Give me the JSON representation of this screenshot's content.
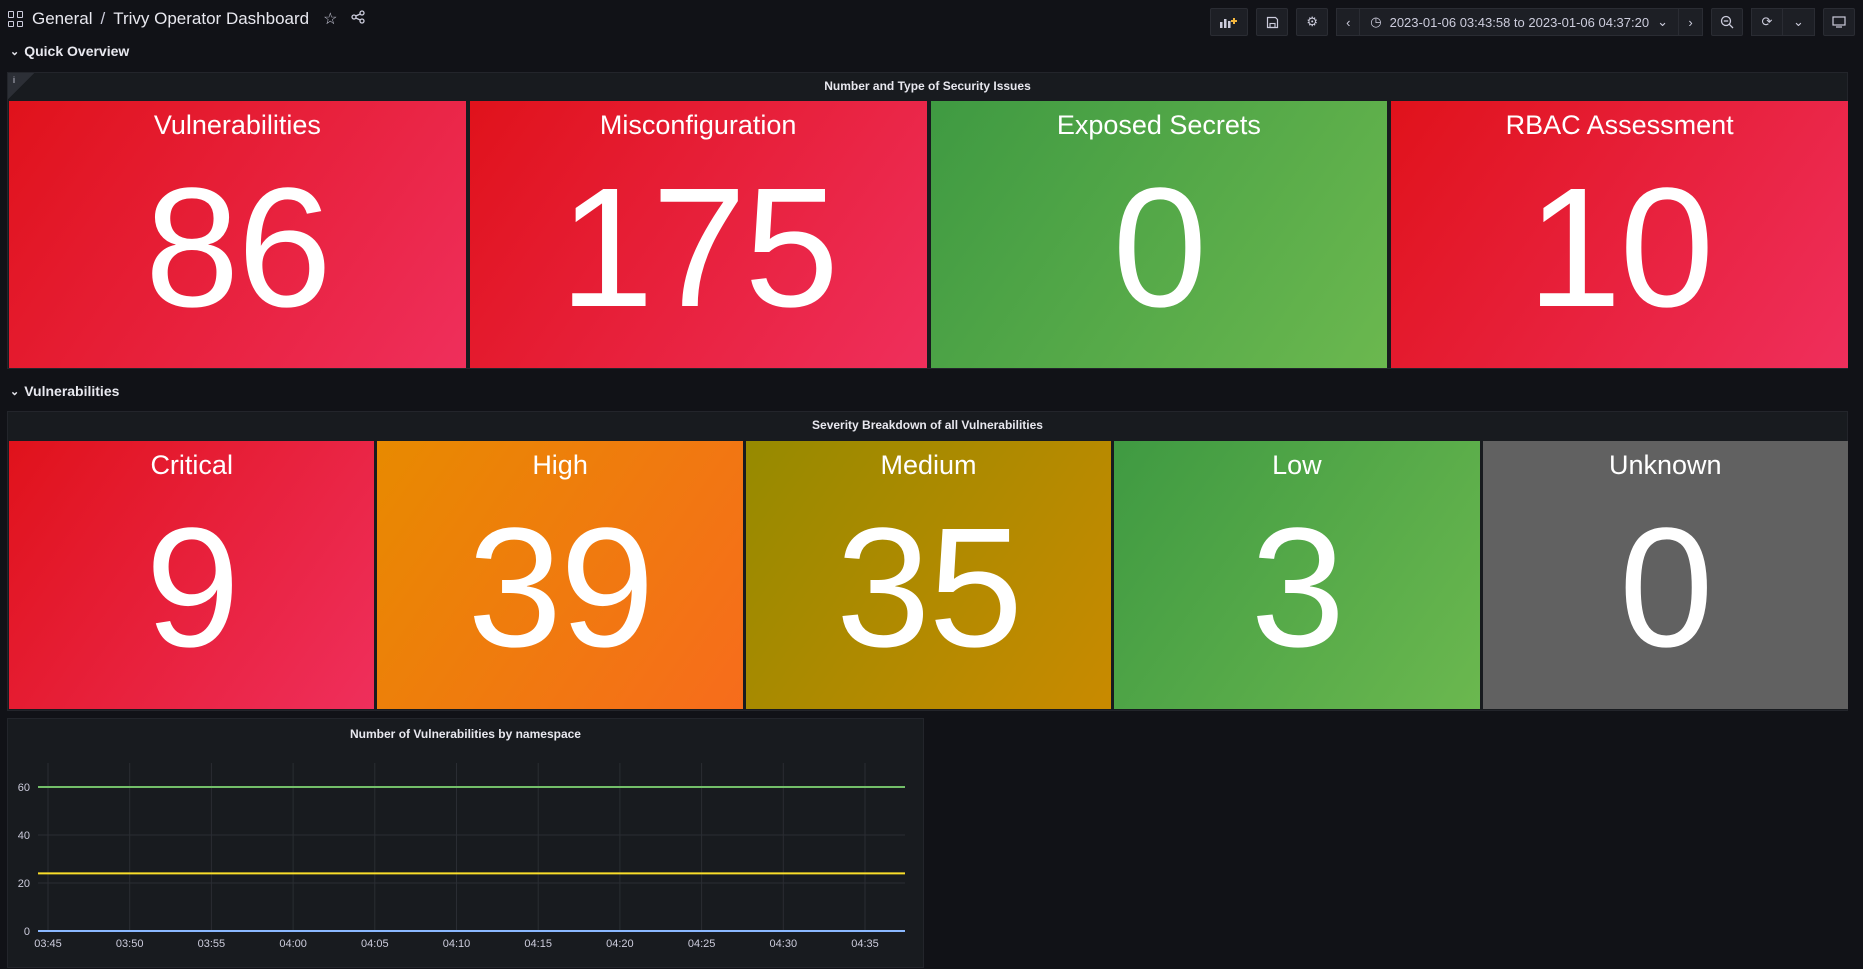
{
  "header": {
    "breadcrumb_root": "General",
    "separator": "/",
    "dashboard_title": "Trivy Operator Dashboard",
    "time_range": "2023-01-06 03:43:58 to 2023-01-06 04:37:20"
  },
  "sections": {
    "quick_overview": "Quick Overview",
    "vulnerabilities": "Vulnerabilities"
  },
  "panels": {
    "security_issues_title": "Number and Type of Security Issues",
    "security_issues_info": "i",
    "severity_title": "Severity Breakdown of all Vulnerabilities",
    "namespace_chart_title": "Number of Vulnerabilities by namespace"
  },
  "security_issues": [
    {
      "label": "Vulnerabilities",
      "value": "86",
      "color": "#e0121b"
    },
    {
      "label": "Misconfiguration",
      "value": "175",
      "color": "#e0121b"
    },
    {
      "label": "Exposed Secrets",
      "value": "0",
      "color": "#3f9a42"
    },
    {
      "label": "RBAC Assessment",
      "value": "10",
      "color": "#e0121b"
    }
  ],
  "severity": [
    {
      "label": "Critical",
      "value": "9",
      "color": "#e0121b"
    },
    {
      "label": "High",
      "value": "39",
      "color": "#e88a00"
    },
    {
      "label": "Medium",
      "value": "35",
      "color": "#968a00"
    },
    {
      "label": "Low",
      "value": "3",
      "color": "#3f9a42"
    },
    {
      "label": "Unknown",
      "value": "0",
      "color": "#616161"
    }
  ],
  "chart_data": {
    "type": "line",
    "title": "Number of Vulnerabilities by namespace",
    "x": [
      "03:45",
      "03:50",
      "03:55",
      "04:00",
      "04:05",
      "04:10",
      "04:15",
      "04:20",
      "04:25",
      "04:30",
      "04:35"
    ],
    "ylim": [
      0,
      70
    ],
    "yticks": [
      0,
      20,
      40,
      60
    ],
    "grid": true,
    "series": [
      {
        "color": "#73bf69",
        "values": [
          60,
          60,
          60,
          60,
          60,
          60,
          60,
          60,
          60,
          60,
          60
        ]
      },
      {
        "color": "#fade2a",
        "values": [
          24,
          24,
          24,
          24,
          24,
          24,
          24,
          24,
          24,
          24,
          24
        ]
      },
      {
        "color": "#8ab8ff",
        "values": [
          0,
          0,
          0,
          0,
          0,
          0,
          0,
          0,
          0,
          0,
          0
        ]
      }
    ]
  }
}
